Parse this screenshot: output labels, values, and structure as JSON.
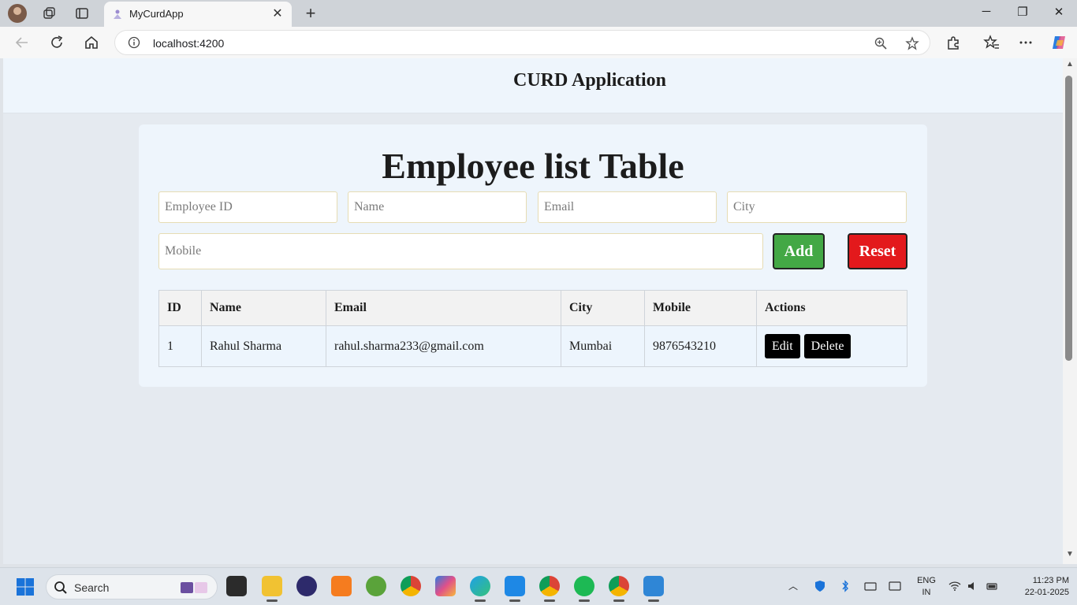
{
  "browser": {
    "tab_title": "MyCurdApp",
    "url": "localhost:4200",
    "icons": [
      "profile-avatar",
      "workspaces-icon",
      "tab-actions-icon",
      "close-icon",
      "plus-icon",
      "minimize-icon",
      "restore-icon",
      "back-icon",
      "refresh-icon",
      "home-icon",
      "info-icon",
      "zoom-icon",
      "star-icon",
      "extensions-icon",
      "favorites-icon",
      "more-icon",
      "copilot-icon"
    ]
  },
  "app": {
    "header_title": "CURD Application",
    "card_title": "Employee list Table",
    "form": {
      "employee_id_placeholder": "Employee ID",
      "name_placeholder": "Name",
      "email_placeholder": "Email",
      "city_placeholder": "City",
      "mobile_placeholder": "Mobile",
      "add_label": "Add",
      "reset_label": "Reset"
    },
    "table": {
      "headers": [
        "ID",
        "Name",
        "Email",
        "City",
        "Mobile",
        "Actions"
      ],
      "rows": [
        {
          "id": "1",
          "name": "Rahul Sharma",
          "email": "rahul.sharma233@gmail.com",
          "city": "Mumbai",
          "mobile": "9876543210",
          "edit_label": "Edit",
          "delete_label": "Delete"
        }
      ]
    }
  },
  "taskbar": {
    "search_label": "Search",
    "lang_line1": "ENG",
    "lang_line2": "IN",
    "time": "11:23 PM",
    "date": "22-01-2025",
    "colors": {
      "add_button": "#43a845",
      "reset_button": "#e3191c"
    }
  }
}
